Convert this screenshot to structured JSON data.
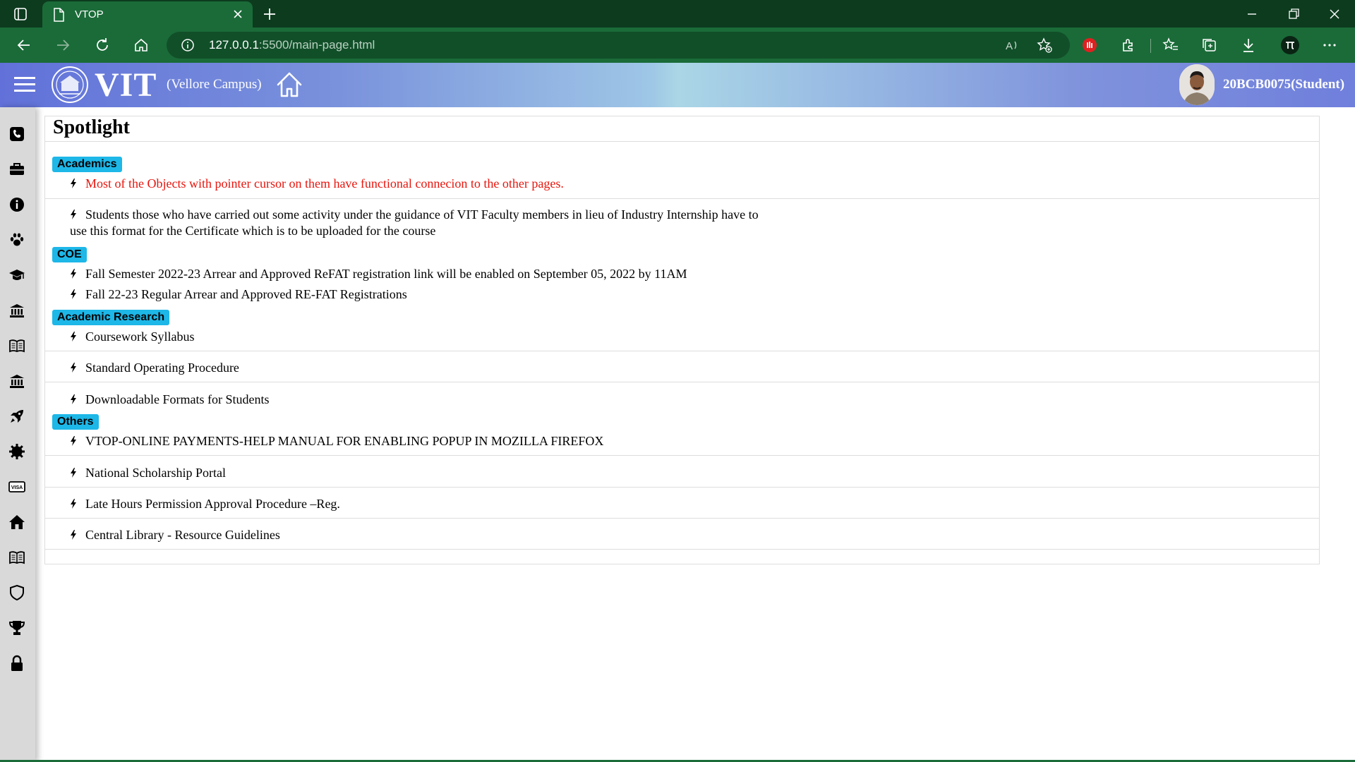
{
  "browser": {
    "tab_title": "VTOP",
    "url_host": "127.0.0.1",
    "url_rest": ":5500/main-page.html"
  },
  "header": {
    "brand": "VIT",
    "campus": "(Vellore Campus)",
    "user": "20BCB0075(Student)"
  },
  "spotlight": {
    "title": "Spotlight",
    "sections": {
      "academics": {
        "label": "Academics",
        "items": [
          "Most of the Objects with pointer cursor on them have functional connecion to the other pages.",
          "Students those who have carried out some activity under the guidance of VIT Faculty members in lieu of Industry Internship have to use this format for the Certificate which is to be uploaded for the course"
        ]
      },
      "coe": {
        "label": "COE",
        "items": [
          "Fall Semester 2022-23 Arrear and Approved ReFAT registration link will be enabled on September 05, 2022 by 11AM",
          "Fall 22-23 Regular Arrear and Approved RE-FAT Registrations"
        ]
      },
      "research": {
        "label": "Academic Research",
        "items": [
          "Coursework Syllabus",
          "Standard Operating Procedure",
          "Downloadable Formats for Students"
        ]
      },
      "others": {
        "label": "Others",
        "items": [
          "VTOP-ONLINE PAYMENTS-HELP MANUAL FOR ENABLING POPUP IN MOZILLA FIREFOX",
          "National Scholarship Portal",
          "Late Hours Permission Approval Procedure –Reg.",
          "Central Library - Resource Guidelines"
        ]
      }
    }
  },
  "colors": {
    "badge": "#1db7e8",
    "highlight_text": "#e8140c",
    "browser_green": "#1a6b38"
  },
  "sidebar_icons": [
    "phone-icon",
    "briefcase-icon",
    "info-icon",
    "paw-icon",
    "graduation-cap-icon",
    "bank-icon",
    "book-icon",
    "bank-icon",
    "rocket-icon",
    "gear-icon",
    "visa-icon",
    "home-icon",
    "book-icon",
    "shield-icon",
    "trophy-icon",
    "lock-icon"
  ]
}
